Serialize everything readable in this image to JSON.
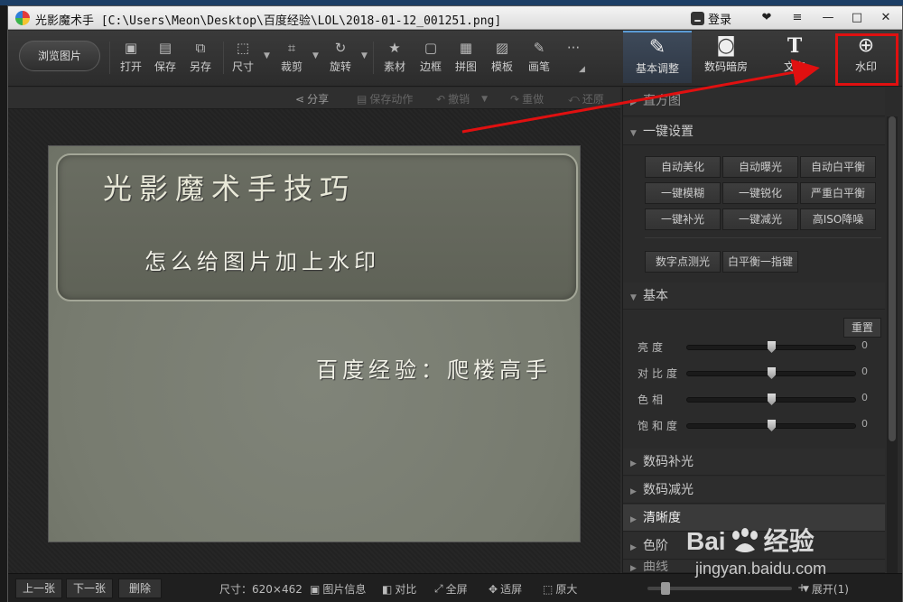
{
  "window": {
    "app_name": "光影魔术手",
    "file_path": "[C:\\Users\\Meon\\Desktop\\百度经验\\LOL\\2018-01-12_001251.png]",
    "login_label": "登录"
  },
  "toolbar": {
    "browse_label": "浏览图片",
    "tools": [
      {
        "label": "打开",
        "icon": "open-icon"
      },
      {
        "label": "保存",
        "icon": "save-icon"
      },
      {
        "label": "另存",
        "icon": "save-as-icon"
      },
      {
        "label": "尺寸",
        "icon": "resize-icon"
      },
      {
        "label": "裁剪",
        "icon": "crop-icon"
      },
      {
        "label": "旋转",
        "icon": "rotate-icon"
      },
      {
        "label": "素材",
        "icon": "material-icon"
      },
      {
        "label": "边框",
        "icon": "border-icon"
      },
      {
        "label": "拼图",
        "icon": "collage-icon"
      },
      {
        "label": "模板",
        "icon": "template-icon"
      },
      {
        "label": "画笔",
        "icon": "brush-icon"
      }
    ],
    "more_label": "···"
  },
  "right_tabs": [
    {
      "label": "基本调整",
      "icon": "adjust-icon",
      "active": true
    },
    {
      "label": "数码暗房",
      "icon": "darkroom-icon",
      "active": false
    },
    {
      "label": "文字",
      "icon": "text-icon",
      "active": false
    },
    {
      "label": "水印",
      "icon": "watermark-icon",
      "active": false
    }
  ],
  "sub_toolbar": {
    "share": "分享",
    "save_action": "保存动作",
    "undo": "撤销",
    "redo": "重做",
    "restore": "还原"
  },
  "photo": {
    "title": "光影魔术手技巧",
    "subtitle": "怎么给图片加上水印",
    "watermark": "百度经验：爬楼高手"
  },
  "panel": {
    "histogram": "直方图",
    "one_click": "一键设置",
    "one_click_buttons": [
      "自动美化",
      "自动曝光",
      "自动白平衡",
      "一键模糊",
      "一键锐化",
      "严重白平衡",
      "一键补光",
      "一键减光",
      "高ISO降噪"
    ],
    "extra_buttons": [
      "数字点测光",
      "白平衡一指键"
    ],
    "basic": "基本",
    "reset": "重置",
    "sliders": [
      {
        "label": "亮度",
        "value": "0",
        "level": 0.5
      },
      {
        "label": "对比度",
        "value": "0",
        "level": 0.5
      },
      {
        "label": "色相",
        "value": "0",
        "level": 0.5
      },
      {
        "label": "饱和度",
        "value": "0",
        "level": 0.5
      }
    ],
    "sections": [
      "数码补光",
      "数码减光",
      "清晰度",
      "色阶",
      "曲线"
    ]
  },
  "statusbar": {
    "prev": "上一张",
    "next": "下一张",
    "delete": "删除",
    "size": "尺寸：620×462",
    "info": "图片信息",
    "compare": "对比",
    "fullscreen": "全屏",
    "fit": "适屏",
    "original": "原大",
    "expand": "展开(1)",
    "zoom_level": 0.1
  },
  "watermark_site": {
    "logo_left": "Bai",
    "logo_right": "经验",
    "url": "jingyan.baidu.com"
  },
  "colors": {
    "highlight": "#e01010",
    "accent": "#5b9bd5"
  }
}
